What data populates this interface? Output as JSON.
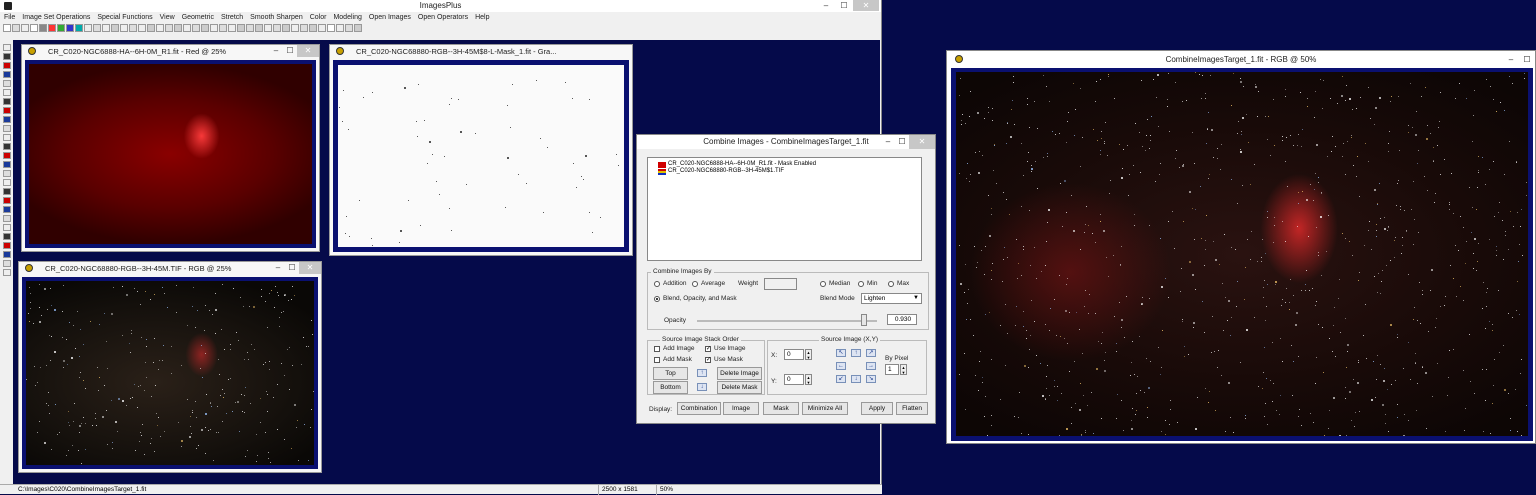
{
  "app": {
    "title": "ImagesPlus",
    "menu": [
      "File",
      "Image Set Operations",
      "Special Functions",
      "View",
      "Geometric",
      "Stretch",
      "Smooth Sharpen",
      "Color",
      "Modeling",
      "Open Images",
      "Open Operators",
      "Help"
    ],
    "minimize": "–",
    "maximize": "☐",
    "close": "✕",
    "status": {
      "path": "C:\\Images\\C020\\CombineImagesTarget_1.fit",
      "dimensions": "2500 x 1581",
      "zoom": "50%"
    }
  },
  "windows": {
    "ha": {
      "title": "CR_C020-NGC6888-HA--6H-0M_R1.fit - Red @ 25%"
    },
    "mask": {
      "title": "CR_C020-NGC68880-RGB--3H-45M$8-L-Mask_1.fit - Gra..."
    },
    "rgb": {
      "title": "CR_C020-NGC68880-RGB--3H-45M.TIF - RGB @ 25%"
    },
    "target": {
      "title": "CombineImagesTarget_1.fit - RGB @ 50%"
    }
  },
  "dialog": {
    "title": "Combine Images - CombineImagesTarget_1.fit",
    "list_items": [
      {
        "text": "CR_C020-NGC6888-HA--6H-0M_R1.fit - Mask Enabled"
      },
      {
        "text": "CR_C020-NGC68880-RGB--3H-45M$1.TIF"
      }
    ],
    "combine_by": {
      "label": "Combine Images By",
      "addition": "Addition",
      "average": "Average",
      "weight": "Weight",
      "median": "Median",
      "min": "Min",
      "max": "Max",
      "blend": "Blend, Opacity, and Mask",
      "blend_mode_label": "Blend Mode",
      "blend_mode_value": "Lighten",
      "opacity_label": "Opacity",
      "opacity_value": "0.930",
      "opacity": 0.93
    },
    "stack": {
      "label": "Source Image Stack Order",
      "add_image": "Add Image",
      "use_image": "Use Image",
      "add_mask": "Add Mask",
      "use_mask": "Use Mask",
      "top": "Top",
      "bottom": "Bottom",
      "delete_image": "Delete Image",
      "delete_mask": "Delete Mask"
    },
    "source": {
      "label": "Source Image (X,Y)",
      "x_label": "X:",
      "x_value": "0",
      "y_label": "Y:",
      "y_value": "0",
      "by_pixel_label": "By Pixel",
      "by_pixel_value": "1"
    },
    "display": {
      "label": "Display:",
      "combination": "Combination",
      "image": "Image",
      "mask": "Mask",
      "minimize_all": "Minimize All",
      "apply": "Apply",
      "flatten": "Flatten"
    }
  }
}
